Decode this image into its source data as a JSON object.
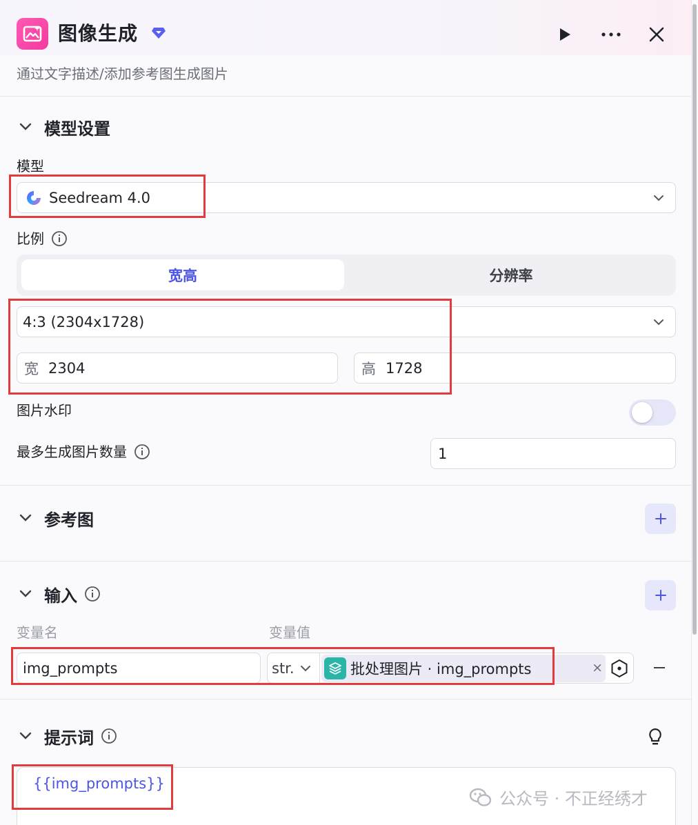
{
  "header": {
    "title": "图像生成",
    "subtitle": "通过文字描述/添加参考图生成图片"
  },
  "model_settings": {
    "section_title": "模型设置",
    "model_label": "模型",
    "model_value": "Seedream 4.0",
    "ratio_label": "比例",
    "ratio_tabs": [
      "宽高",
      "分辨率"
    ],
    "aspect_value": "4:3 (2304x1728)",
    "width_prefix": "宽",
    "width_value": "2304",
    "height_prefix": "高",
    "height_value": "1728",
    "watermark_label": "图片水印",
    "count_label": "最多生成图片数量",
    "count_value": "1"
  },
  "reference": {
    "section_title": "参考图"
  },
  "inputs": {
    "section_title": "输入",
    "col_name": "变量名",
    "col_value": "变量值",
    "row": {
      "name": "img_prompts",
      "type": "str.",
      "ref_text": "批处理图片 · img_prompts",
      "clear": "×"
    }
  },
  "prompt": {
    "section_title": "提示词",
    "text": "{{img_prompts}}"
  },
  "watermark": {
    "text": "公众号 · 不正经绣才"
  },
  "colors": {
    "accent": "#4d55e8",
    "app_icon": "#f23aa0",
    "highlight": "#e33b3b"
  }
}
